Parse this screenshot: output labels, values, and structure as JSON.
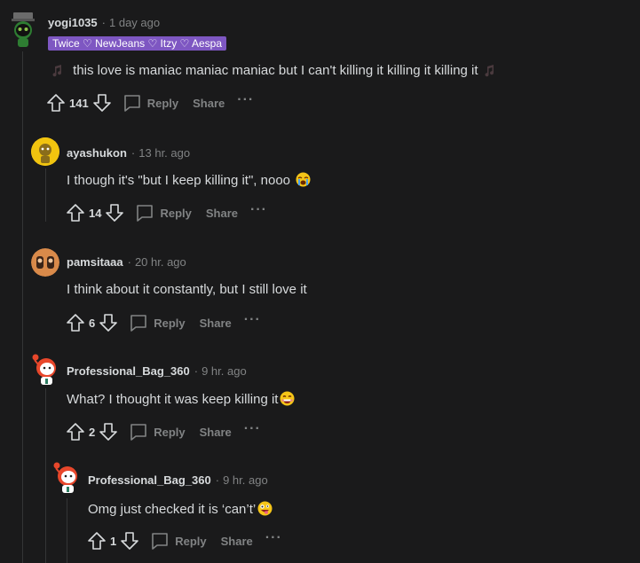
{
  "comments": [
    {
      "author": "yogi1035",
      "time": "1 day ago",
      "flair": "Twice ♡ NewJeans ♡ Itzy ♡ Aespa",
      "body": "this love is maniac maniac maniac but I can't killing it killing it killing it",
      "score": "141",
      "reply_label": "Reply",
      "share_label": "Share",
      "more_label": "···"
    },
    {
      "author": "ayashukon",
      "time": "13 hr. ago",
      "body": "I though it's \"but I keep killing it\", nooo",
      "score": "14",
      "reply_label": "Reply",
      "share_label": "Share",
      "more_label": "···"
    },
    {
      "author": "pamsitaaa",
      "time": "20 hr. ago",
      "body": "I think about it constantly, but I still love it",
      "score": "6",
      "reply_label": "Reply",
      "share_label": "Share",
      "more_label": "···"
    },
    {
      "author": "Professional_Bag_360",
      "time": "9 hr. ago",
      "body": "What? I thought it was keep killing it",
      "score": "2",
      "reply_label": "Reply",
      "share_label": "Share",
      "more_label": "···"
    },
    {
      "author": "Professional_Bag_360",
      "time": "9 hr. ago",
      "body": "Omg just checked it is ‘can’t’",
      "score": "1",
      "reply_label": "Reply",
      "share_label": "Share",
      "more_label": "···"
    }
  ],
  "dot": "·"
}
